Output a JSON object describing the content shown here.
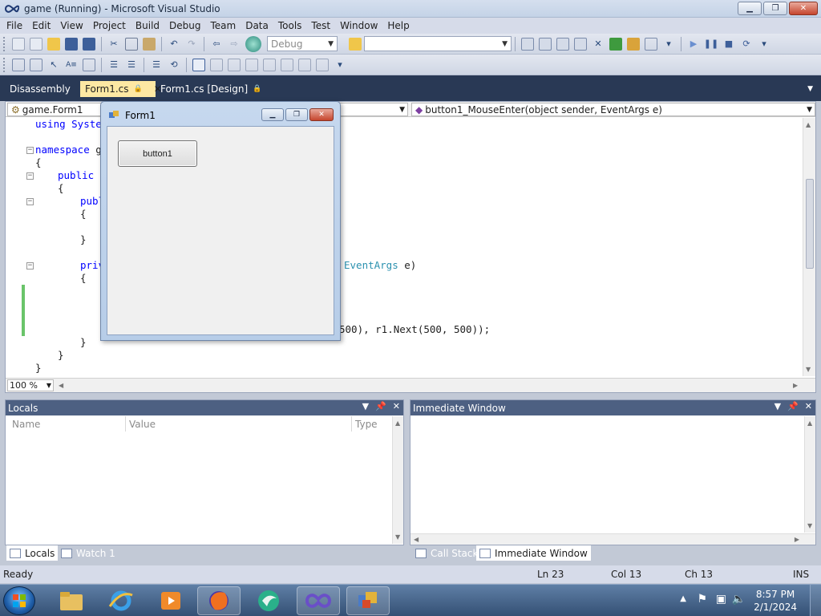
{
  "window": {
    "title": "game (Running) - Microsoft Visual Studio",
    "minimize": "▁",
    "restore": "❐",
    "close": "✕"
  },
  "menu": [
    "File",
    "Edit",
    "View",
    "Project",
    "Build",
    "Debug",
    "Team",
    "Data",
    "Tools",
    "Test",
    "Window",
    "Help"
  ],
  "toolbar": {
    "config_value": "Debug",
    "find_value": ""
  },
  "doc_tabs": {
    "disassembly": "Disassembly",
    "form1_cs": "Form1.cs",
    "form1_design": "Form1.cs [Design]",
    "close_glyph": "✕",
    "lock_glyph": "🔒"
  },
  "editor": {
    "type_combo": "game.Form1",
    "member_combo": "button1_MouseEnter(object sender, EventArgs e)",
    "zoom": "100 %",
    "lines": {
      "l1": "using System",
      "l3_kw": "namespace",
      "l3_rest": " ga",
      "l4": "{",
      "l5_kw": "public",
      "l5_rest": " p",
      "l6": "{",
      "l7": "publ",
      "l8": "{",
      "l10": "}",
      "l12": "priv",
      "l12_ty": "EventArgs",
      "l12_rest": " e)",
      "l13": "{",
      "l16": "500), r1.Next(500, 500));",
      "l17": "}",
      "l18": "}",
      "l19": "}"
    }
  },
  "form1": {
    "title": "Form1",
    "button_label": "button1"
  },
  "locals": {
    "title": "Locals",
    "col_name": "Name",
    "col_value": "Value",
    "col_type": "Type"
  },
  "immediate": {
    "title": "Immediate Window"
  },
  "bottom_tabs": {
    "locals": "Locals",
    "watch1": "Watch 1",
    "call_stack": "Call Stack",
    "immediate": "Immediate Window"
  },
  "status": {
    "ready": "Ready",
    "ln": "Ln 23",
    "col": "Col 13",
    "ch": "Ch 13",
    "ins": "INS"
  },
  "taskbar": {
    "time": "8:57 PM",
    "date": "2/1/2024"
  },
  "colors": {
    "accent_tab": "#fde8a3",
    "doc_strip": "#293955",
    "tool_header": "#4d6082"
  }
}
